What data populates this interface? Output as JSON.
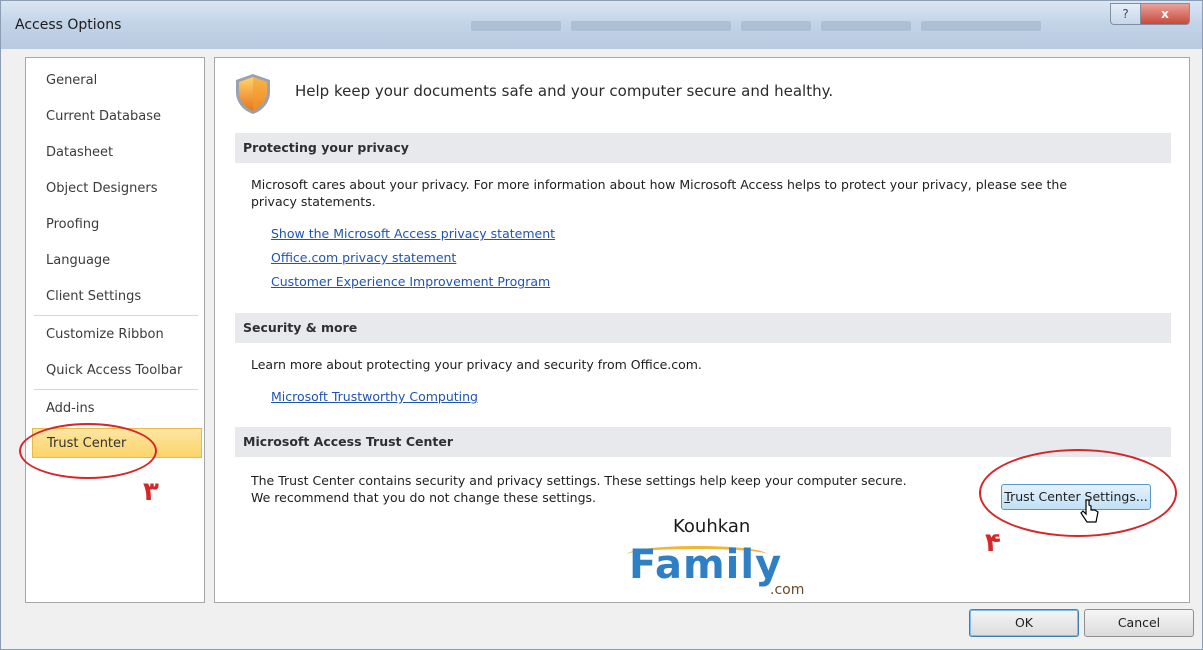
{
  "window": {
    "title": "Access Options"
  },
  "title_buttons": {
    "help": "?",
    "close": "x"
  },
  "sidebar": {
    "items": [
      {
        "label": "General"
      },
      {
        "label": "Current Database"
      },
      {
        "label": "Datasheet"
      },
      {
        "label": "Object Designers"
      },
      {
        "label": "Proofing"
      },
      {
        "label": "Language"
      },
      {
        "label": "Client Settings"
      },
      {
        "label": "Customize Ribbon"
      },
      {
        "label": "Quick Access Toolbar"
      },
      {
        "label": "Add-ins"
      },
      {
        "label": "Trust Center"
      }
    ],
    "selected": "Trust Center"
  },
  "main": {
    "header": "Help keep your documents safe and your computer secure and healthy.",
    "privacy": {
      "heading": "Protecting your privacy",
      "text_line1": "Microsoft cares about your privacy. For more information about how Microsoft Access helps to protect your privacy, please see the",
      "text_line2": "privacy statements.",
      "links": [
        "Show the Microsoft Access privacy statement",
        "Office.com privacy statement",
        "Customer Experience Improvement Program"
      ]
    },
    "security": {
      "heading": "Security & more",
      "text": "Learn more about protecting your privacy and security from Office.com.",
      "link": "Microsoft Trustworthy Computing"
    },
    "trust_center": {
      "heading": "Microsoft Access Trust Center",
      "text_line1": "The Trust Center contains security and privacy settings. These settings help keep your computer secure.",
      "text_line2": "We recommend that you do not change these settings.",
      "button_first": "T",
      "button_rest": "rust Center Settings..."
    }
  },
  "watermark": {
    "top": "Kouhkan",
    "main": "Family",
    "suffix": ".com"
  },
  "annotations": {
    "step3": "۳",
    "step4": "۴"
  },
  "footer": {
    "ok": "OK",
    "cancel": "Cancel"
  },
  "colors": {
    "selected_nav": "#fcd469",
    "link": "#1f55b0",
    "annotation": "#d62628"
  }
}
